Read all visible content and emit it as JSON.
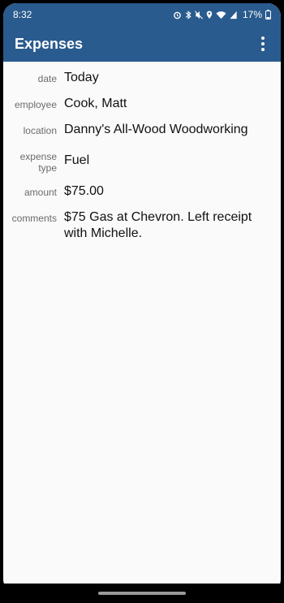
{
  "status": {
    "time": "8:32",
    "battery": "17%",
    "icons": [
      "alarm-icon",
      "bluetooth-icon",
      "mute-icon",
      "location-icon",
      "wifi-icon",
      "signal-icon",
      "battery-icon"
    ]
  },
  "app_bar": {
    "title": "Expenses",
    "menu_icon": "more-vert-icon"
  },
  "fields": [
    {
      "label": "date",
      "value": "Today"
    },
    {
      "label": "employee",
      "value": "Cook, Matt"
    },
    {
      "label": "location",
      "value": "Danny's All-Wood Woodworking"
    },
    {
      "label": "expense type",
      "value": "Fuel"
    },
    {
      "label": "amount",
      "value": "$75.00"
    },
    {
      "label": "comments",
      "value": "$75 Gas at Chevron. Left receipt with Michelle."
    }
  ],
  "colors": {
    "primary": "#2a5b8e",
    "background": "#fafafa",
    "label": "#6b6b6b",
    "value": "#111111"
  }
}
